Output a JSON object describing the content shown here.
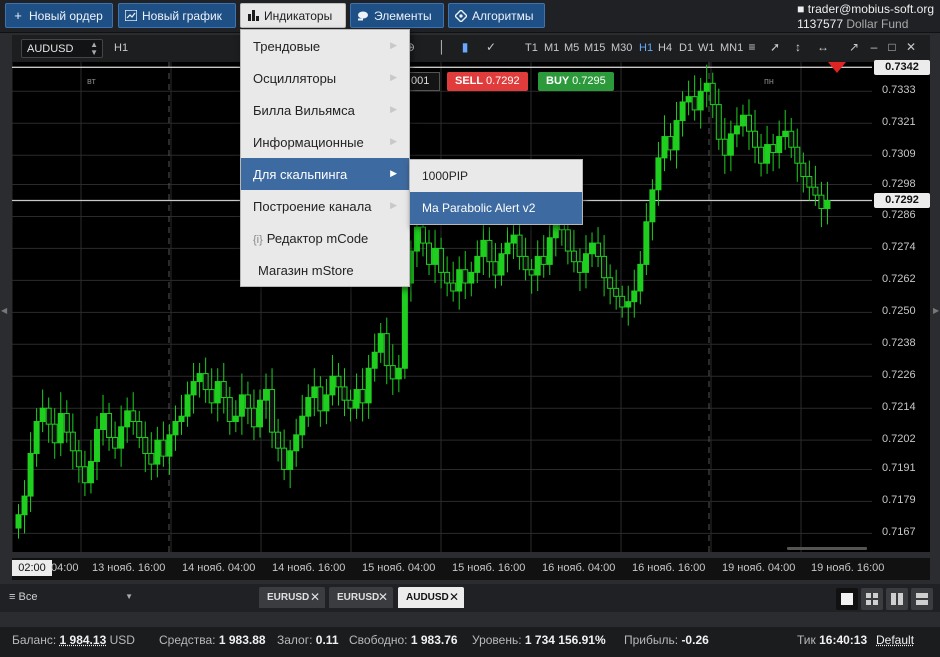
{
  "toolbar": {
    "new_order": "Новый ордер",
    "new_chart": "Новый график",
    "indicators": "Индикаторы",
    "elements": "Элементы",
    "algorithms": "Алгоритмы"
  },
  "account": {
    "user": "trader@mobius-soft.org",
    "number": "1137577",
    "name": "Dollar Fund"
  },
  "chart_header": {
    "symbol": "AUDUSD",
    "period": "H1",
    "timeframes": [
      "T1",
      "M1",
      "M5",
      "M15",
      "M30",
      "H1",
      "H4",
      "D1",
      "W1",
      "MN1"
    ],
    "active_timeframe": "H1"
  },
  "trade": {
    "qty": "001",
    "sell_label": "SELL",
    "sell_price": "0.7292",
    "buy_label": "BUY",
    "buy_price": "0.7295"
  },
  "menu": {
    "items": [
      "Трендовые",
      "Осцилляторы",
      "Билла Вильямса",
      "Информационные",
      "Для скальпинга",
      "Построение канала",
      "Редактор mCode",
      "Магазин mStore"
    ],
    "highlighted": "Для скальпинга",
    "submenu": [
      "1000PIP",
      "Ma Parabolic Alert v2"
    ],
    "submenu_highlighted": "Ma Parabolic Alert v2"
  },
  "chart_data": {
    "type": "candlestick",
    "symbol": "AUDUSD",
    "timeframe": "H1",
    "day_labels": [
      "вт",
      "пн"
    ],
    "price_ticks": [
      "0.7333",
      "0.7321",
      "0.7309",
      "0.7298",
      "0.7286",
      "0.7274",
      "0.7262",
      "0.7250",
      "0.7238",
      "0.7226",
      "0.7214",
      "0.7202",
      "0.7191",
      "0.7179",
      "0.7167"
    ],
    "ylim": [
      0.716,
      0.7344
    ],
    "current_price_labels": [
      "0.7342",
      "0.7292"
    ],
    "time_ticks": [
      "04:00",
      "13 нояб. 16:00",
      "14 нояб. 04:00",
      "14 нояб. 16:00",
      "15 нояб. 04:00",
      "15 нояб. 16:00",
      "16 нояб. 04:00",
      "16 нояб. 16:00",
      "19 нояб. 04:00",
      "19 нояб. 16:00"
    ],
    "cursor_time": "02:00",
    "closes": [
      0.7174,
      0.7181,
      0.7197,
      0.7209,
      0.7214,
      0.7208,
      0.7201,
      0.7212,
      0.7205,
      0.7198,
      0.7192,
      0.7186,
      0.7194,
      0.7206,
      0.7212,
      0.7203,
      0.7199,
      0.7207,
      0.7213,
      0.7209,
      0.7203,
      0.7197,
      0.7193,
      0.7202,
      0.7196,
      0.7204,
      0.7209,
      0.7211,
      0.7219,
      0.7224,
      0.7227,
      0.7221,
      0.7216,
      0.7224,
      0.7218,
      0.7209,
      0.7211,
      0.7219,
      0.7214,
      0.7207,
      0.7217,
      0.7221,
      0.7205,
      0.7199,
      0.7191,
      0.7198,
      0.7204,
      0.7211,
      0.7218,
      0.7222,
      0.7213,
      0.7219,
      0.7226,
      0.7222,
      0.7217,
      0.7214,
      0.7221,
      0.7216,
      0.7229,
      0.7235,
      0.7242,
      0.723,
      0.7225,
      0.7229,
      0.7261,
      0.7273,
      0.7282,
      0.7276,
      0.7268,
      0.7274,
      0.7265,
      0.7261,
      0.7258,
      0.7266,
      0.7261,
      0.7265,
      0.7271,
      0.7277,
      0.7269,
      0.7264,
      0.7272,
      0.7276,
      0.7279,
      0.7271,
      0.7266,
      0.7264,
      0.7271,
      0.7268,
      0.7278,
      0.7284,
      0.7281,
      0.7273,
      0.7269,
      0.7265,
      0.7272,
      0.7276,
      0.7271,
      0.7263,
      0.7259,
      0.7256,
      0.7252,
      0.7254,
      0.7258,
      0.7268,
      0.7284,
      0.7296,
      0.7308,
      0.7316,
      0.7311,
      0.7322,
      0.7329,
      0.7331,
      0.7326,
      0.7333,
      0.7336,
      0.7328,
      0.7315,
      0.7309,
      0.7317,
      0.732,
      0.7324,
      0.7318,
      0.7312,
      0.7306,
      0.7313,
      0.731,
      0.7316,
      0.7318,
      0.7312,
      0.7306,
      0.7301,
      0.7297,
      0.7294,
      0.7289,
      0.7292
    ]
  },
  "chart_tabs": [
    "EURUSD",
    "EURUSD",
    "AUDUSD"
  ],
  "active_tab": "AUDUSD",
  "filter": "Все",
  "status": {
    "balance_label": "Баланс:",
    "balance": "1 984.13",
    "currency": "USD",
    "equity_label": "Средства:",
    "equity": "1 983.88",
    "margin_label": "Залог:",
    "margin": "0.11",
    "free_label": "Свободно:",
    "free": "1 983.76",
    "level_label": "Уровень:",
    "level": "1 734 156.91%",
    "profit_label": "Прибыль:",
    "profit": "-0.26",
    "tick_label": "Тик",
    "tick": "16:40:13",
    "default": "Default"
  },
  "colors": {
    "up": "#1fcf1f",
    "accent": "#1e4f85",
    "sell": "#e03c3c",
    "buy": "#2c9a3a"
  }
}
